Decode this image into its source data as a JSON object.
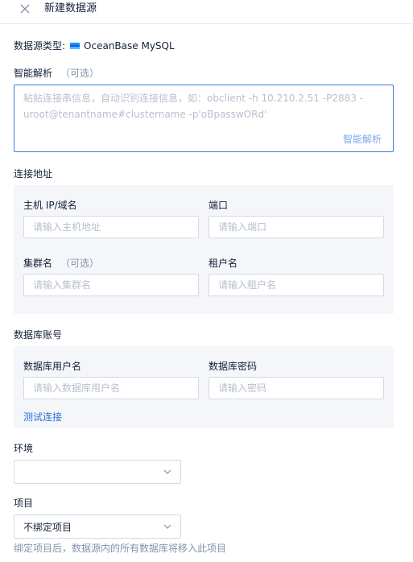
{
  "header": {
    "title": "新建数据源",
    "close_icon": "close-icon"
  },
  "datasource_type": {
    "label": "数据源类型:",
    "value": "OceanBase MySQL",
    "icon": "oceanbase-logo-icon"
  },
  "smart_parse": {
    "label": "智能解析",
    "optional": "（可选）",
    "placeholder": "粘贴连接串信息，自动识别连接信息，如：obclient -h 10.210.2.51 -P2883 -uroot@tenantname#clustername -p'oBpasswORd'",
    "action": "智能解析"
  },
  "connection": {
    "section_title": "连接地址",
    "host": {
      "label": "主机 IP/域名",
      "placeholder": "请输入主机地址"
    },
    "port": {
      "label": "端口",
      "placeholder": "请输入端口"
    },
    "cluster": {
      "label": "集群名",
      "optional": "（可选）",
      "placeholder": "请输入集群名"
    },
    "tenant": {
      "label": "租户名",
      "placeholder": "请输入租户名"
    }
  },
  "account": {
    "section_title": "数据库账号",
    "username": {
      "label": "数据库用户名",
      "placeholder": "请输入数据库用户名"
    },
    "password": {
      "label": "数据库密码",
      "placeholder": "请输入密码"
    },
    "test_link": "测试连接"
  },
  "environment": {
    "label": "环境",
    "value": ""
  },
  "project": {
    "label": "项目",
    "value": "不绑定项目",
    "hint": "绑定项目后，数据源内的所有数据库将移入此项目"
  },
  "colors": {
    "accent": "#2c6fd6",
    "focus_border": "#3a7ddb",
    "panel_bg": "#f5f6f9",
    "muted_text": "#8592ad",
    "placeholder": "#b8bfcc"
  }
}
